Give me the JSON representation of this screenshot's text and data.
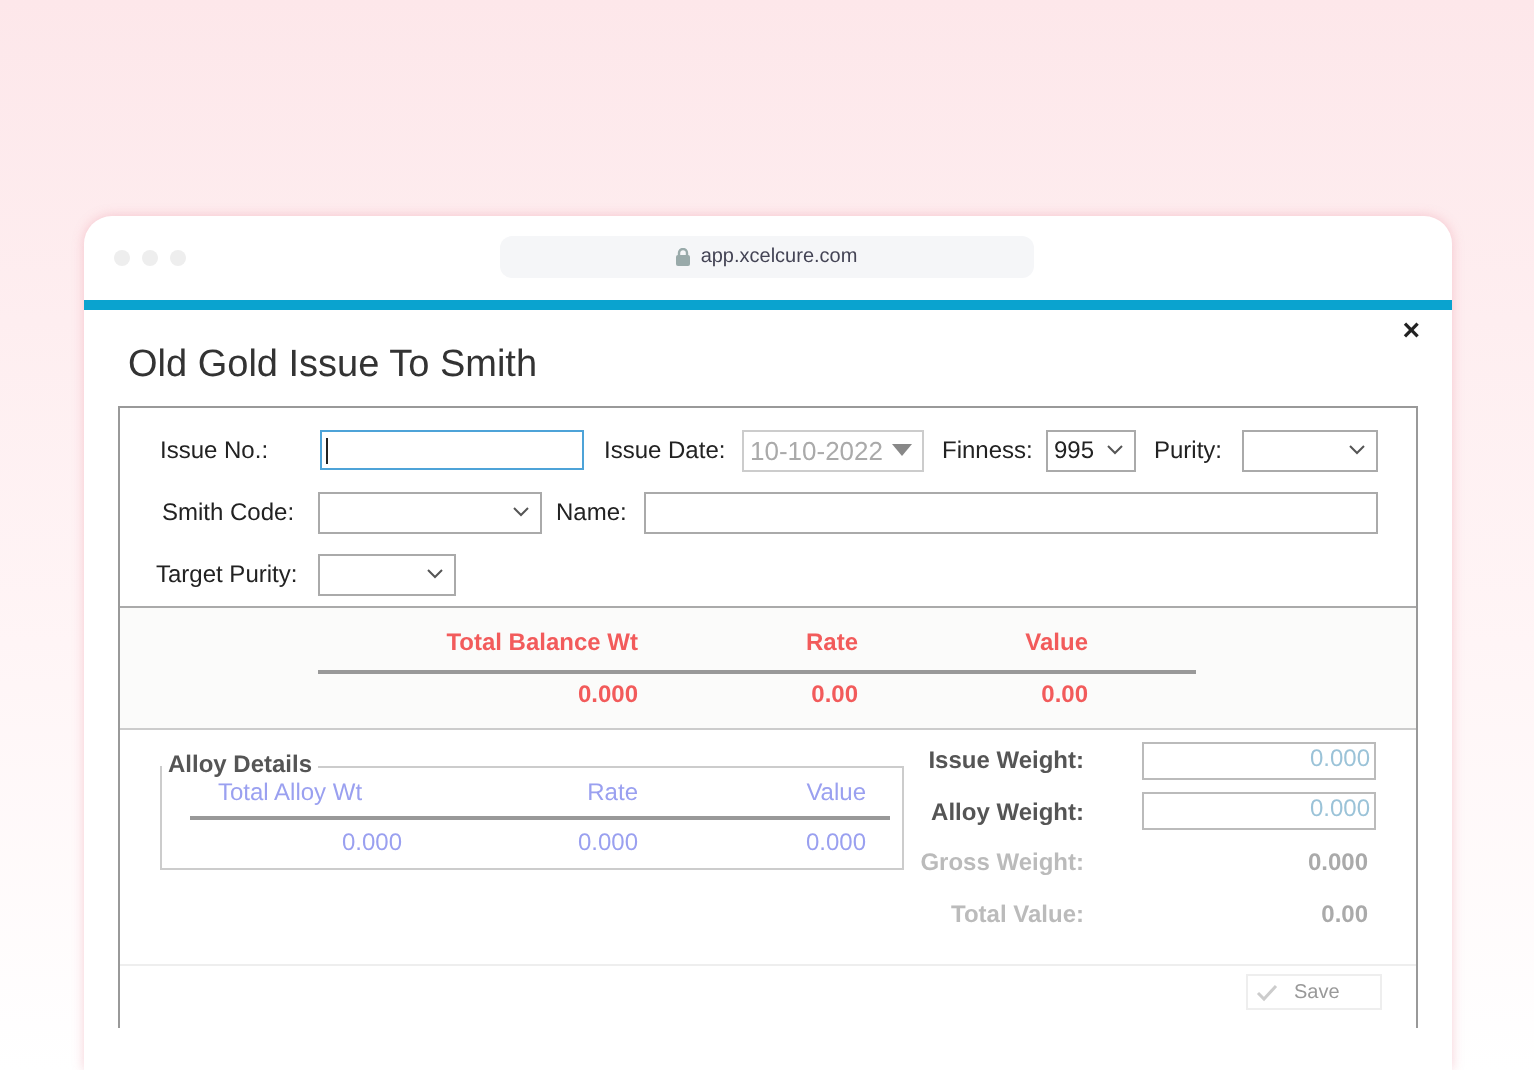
{
  "browser": {
    "url": "app.xcelcure.com"
  },
  "dialog": {
    "title": "Old Gold Issue To Smith",
    "close": "×"
  },
  "header_fields": [
    {
      "label": "Issue No.:",
      "kind": "text",
      "focused": true,
      "disabled": false
    },
    {
      "label": "Issue Date:",
      "kind": "date",
      "value": "10-10-2022",
      "focused": false,
      "disabled": true
    },
    {
      "label": "Finness:",
      "kind": "select",
      "value": "995",
      "focused": false,
      "disabled": false
    },
    {
      "label": "Purity:",
      "kind": "select",
      "focused": false,
      "disabled": false
    },
    {
      "label": "Smith Code:",
      "kind": "select",
      "focused": false,
      "disabled": false
    },
    {
      "label": "Name:",
      "kind": "text",
      "focused": false,
      "disabled": false
    },
    {
      "label": "Target Purity:",
      "kind": "select",
      "focused": false,
      "disabled": false
    }
  ],
  "balance": {
    "columns": [
      "Total Balance Wt",
      "Rate",
      "Value"
    ],
    "values": [
      "0.000",
      "0.00",
      "0.00"
    ]
  },
  "alloy_details": {
    "legend": "Alloy Details",
    "columns": [
      "Total Alloy Wt",
      "Rate",
      "Value"
    ],
    "values": [
      "0.000",
      "0.000",
      "0.000"
    ]
  },
  "totals": [
    {
      "label": "Issue Weight:",
      "kind": "field",
      "value": "0.000"
    },
    {
      "label": "Alloy Weight:",
      "kind": "field",
      "value": "0.000"
    },
    {
      "label": "Gross Weight:",
      "kind": "readout",
      "value": "0.000",
      "disabled": true
    },
    {
      "label": "Total Value:",
      "kind": "readout",
      "value": "0.00",
      "disabled": true
    }
  ],
  "save_button": {
    "label": "Save",
    "disabled": true
  }
}
